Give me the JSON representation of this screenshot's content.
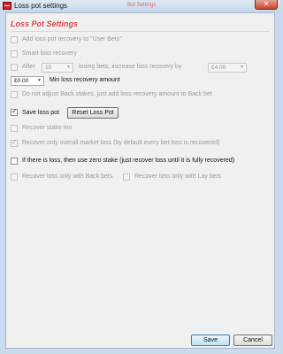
{
  "window": {
    "title": "Loss pot settings",
    "ghost_title": "Bot Settings",
    "close_glyph": "✕",
    "icon": "app-icon"
  },
  "section": {
    "title": "Loss Pot Settings"
  },
  "options": {
    "add_loss_pot_recovery": {
      "label": "Add loss pot recovery to \"User Bets\"",
      "checked": false,
      "enabled": false
    },
    "smart_loss_recovery": {
      "label": "Smart loss recovery",
      "checked": false,
      "enabled": false
    },
    "after": {
      "label": "After",
      "count_value": "10",
      "middle_text": "losing bets, increase loss recovery by",
      "amount_value": "£4.00",
      "checked": false,
      "enabled": false
    },
    "min_loss_recovery": {
      "value": "£0.00",
      "label": "Min loss recovery amount"
    },
    "do_not_adjust": {
      "label": "Do not adjust Back stakes, just add loss recovery amount to Back bet",
      "checked": false,
      "enabled": false
    },
    "save_loss_pot": {
      "label": "Save loss pot",
      "checked": true,
      "enabled": true
    },
    "reset_button": "Reset Loss Pot",
    "recover_stake_too": {
      "label": "Recover stake too",
      "checked": false,
      "enabled": false
    },
    "recover_only_overall": {
      "label": "Recover only overall market loss (by default every bet loss is recovered)",
      "checked": true,
      "enabled": false
    },
    "zero_stake": {
      "label": "If there is loss, then use zero stake (just recover loss until it is fully recovered)",
      "checked": false,
      "enabled": true
    },
    "back_bets_only": {
      "label": "Recover loss only with Back bets",
      "checked": false,
      "enabled": false
    },
    "lay_bets_only": {
      "label": "Recover loss only with Lay bets",
      "checked": false,
      "enabled": false
    }
  },
  "footer": {
    "save": "Save",
    "cancel": "Cancel"
  }
}
